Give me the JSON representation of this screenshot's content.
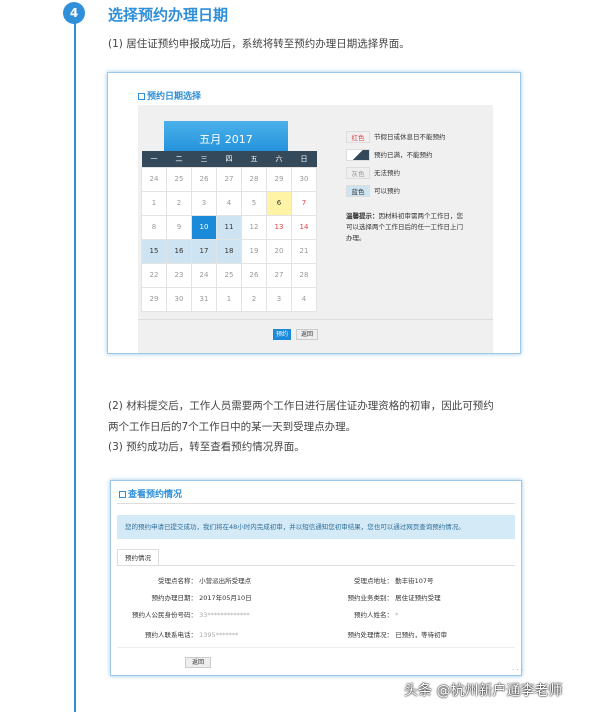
{
  "step_number": "4",
  "step_title": "选择预约办理日期",
  "para1": "(1) 居住证预约申报成功后，系统将转至预约办理日期选择界面。",
  "para2_line1": "(2) 材料提交后，工作人员需要两个工作日进行居住证办理资格的初审，因此可预约",
  "para2_line2": "两个工作日后的7个工作日中的某一天到受理点办理。",
  "para3": "(3) 预约成功后，转至查看预约情况界面。",
  "screen1": {
    "title": "预约日期选择",
    "month": "五月 2017",
    "weekdays": [
      "一",
      "二",
      "三",
      "四",
      "五",
      "六",
      "日"
    ],
    "weeks": [
      [
        "24",
        "25",
        "26",
        "27",
        "28",
        "29",
        "30"
      ],
      [
        "1",
        "2",
        "3",
        "4",
        "5",
        "6",
        "7"
      ],
      [
        "8",
        "9",
        "10",
        "11",
        "12",
        "13",
        "14"
      ],
      [
        "15",
        "16",
        "17",
        "18",
        "19",
        "20",
        "21"
      ],
      [
        "22",
        "23",
        "24",
        "25",
        "26",
        "27",
        "28"
      ],
      [
        "29",
        "30",
        "31",
        "1",
        "2",
        "3",
        "4"
      ]
    ],
    "legend": [
      {
        "swatch": "红色",
        "text": "节假日或休息日不能预约"
      },
      {
        "swatch": "",
        "text": "预约已满，不能预约"
      },
      {
        "swatch": "灰色",
        "text": "无法预约"
      },
      {
        "swatch": "蓝色",
        "text": "可以预约"
      }
    ],
    "tip_label": "温馨提示：",
    "tip_text": "因材料初审需两个工作日，您可以选择两个工作日后的任一工作日上门办理。",
    "reserve_button": "预约",
    "back_button": "返回"
  },
  "screen2": {
    "title": "查看预约情况",
    "notice": "您的预约申请已提交成功，我们将在48小时内完成初审，并以短信通知您初审结果，您也可以通过网页查询预约情况。",
    "tab": "预约情况",
    "left_fields": [
      {
        "label": "受理点名称：",
        "value": "小营派出所受理点"
      },
      {
        "label": "预约办理日期：",
        "value": "2017年05月10日"
      },
      {
        "label": "预约人公民身份号码：",
        "value": "33*************"
      },
      {
        "label": "预约人联系电话：",
        "value": "1395*******"
      }
    ],
    "right_fields": [
      {
        "label": "受理点地址：",
        "value": "勤丰街107号"
      },
      {
        "label": "预约业务类别：",
        "value": "居住证预约受理"
      },
      {
        "label": "预约人姓名：",
        "value": "*"
      },
      {
        "label": "预约处理情况：",
        "value": "已预约，等待初审"
      }
    ],
    "back_button": "返回"
  },
  "watermark": "头条 @杭州新户通李老师"
}
